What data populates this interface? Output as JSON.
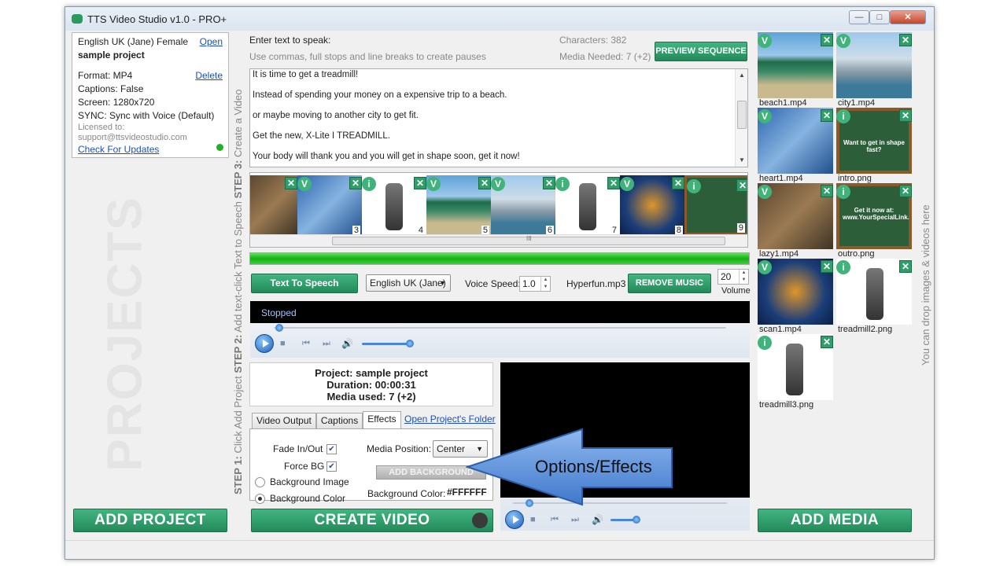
{
  "window": {
    "title": "TTS Video Studio v1.0 - PRO+",
    "min_label": "—",
    "max_label": "□",
    "close_label": "✕"
  },
  "project_info": {
    "voice": "English UK (Jane) Female",
    "open_link": "Open",
    "name": "sample project",
    "format": "Format: MP4",
    "delete_link": "Delete",
    "captions": "Captions: False",
    "screen": "Screen: 1280x720",
    "sync": "SYNC: Sync with Voice (Default)",
    "licensed_label": "Licensed to:",
    "licensed_email": "support@ttsvideostudio.com",
    "check_updates": "Check For Updates"
  },
  "watermark": "PROJECTS",
  "steps": {
    "s1": "STEP 1:",
    "s1t": " Click Add Project ",
    "s2": "STEP 2:",
    "s2t": " Add text-click Text to Speech ",
    "s3": "STEP 3:",
    "s3t": " Create a Video"
  },
  "text_panel": {
    "label": "Enter text to speak:",
    "hint": "Use commas, full stops and line breaks to create pauses",
    "characters": "Characters: 382",
    "media_needed": "Media Needed: 7 (+2)",
    "preview_button": "PREVIEW SEQUENCE",
    "lines": [
      "It is time to get a treadmill!",
      "Instead of spending your money on a expensive trip to a beach.",
      "or maybe moving to another city to get fit.",
      "Get the new, X-Lite I TREADMILL.",
      "Your body will thank you and you will get in shape soon, get it now!"
    ]
  },
  "filmstrip": {
    "numbers": [
      "3",
      "4",
      "5",
      "6",
      "7",
      "8",
      "9"
    ],
    "scroll_grip": "III"
  },
  "progress_percent": 100,
  "tts_row": {
    "tts_button": "Text To Speech",
    "voice_select": "English UK (Jane)",
    "speed_label": "Voice Speed:",
    "speed_value": "1.0",
    "music_file": "Hyperfun.mp3",
    "remove_music": "REMOVE MUSIC",
    "volume_value": "20",
    "volume_label": "Volume"
  },
  "audio_player": {
    "status": "Stopped"
  },
  "summary": {
    "project": "Project: sample project",
    "duration": "Duration: 00:00:31",
    "media_used": "Media used: 7 (+2)"
  },
  "tabs": {
    "video_output": "Video Output",
    "captions": "Captions",
    "effects": "Effects",
    "open_folder": "Open Project's Folder"
  },
  "effects": {
    "fade_label": "Fade In/Out",
    "force_bg_label": "Force BG",
    "bg_image_label": "Background Image",
    "bg_color_label": "Background Color",
    "media_position_label": "Media Position:",
    "media_position_value": "Center",
    "add_background": "ADD BACKGROUND",
    "bg_color_field_label": "Background Color:",
    "bg_color_value": "#FFFFFF"
  },
  "callout": {
    "text": "Options/Effects"
  },
  "buttons": {
    "add_project": "ADD PROJECT",
    "create_video": "CREATE VIDEO",
    "add_media": "ADD MEDIA"
  },
  "media": {
    "items": [
      "beach1.mp4",
      "city1.mp4",
      "heart1.mp4",
      "intro.png",
      "lazy1.mp4",
      "outro.png",
      "scan1.mp4",
      "treadmill2.png",
      "treadmill3.png"
    ],
    "intro_text": "Want to get in shape fast?",
    "outro_text": "Get it now at: www.YourSpecialLink.com",
    "drop_hint": "You can drop images & videos here"
  },
  "badges": {
    "v": "V",
    "i": "i",
    "x": "✕"
  },
  "colors": {
    "accent_green": "#2f9e68",
    "progress_green": "#14b014",
    "callout_blue": "#4a86d8"
  }
}
